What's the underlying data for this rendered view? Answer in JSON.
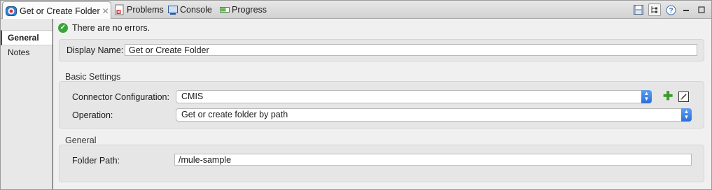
{
  "tabs": [
    {
      "label": "Get or Create Folder",
      "icon": "mule-connector-icon"
    },
    {
      "label": "Problems",
      "icon": "problems-icon"
    },
    {
      "label": "Console",
      "icon": "console-icon"
    },
    {
      "label": "Progress",
      "icon": "progress-icon"
    }
  ],
  "close_glyph": "✕",
  "nav": {
    "items": [
      {
        "label": "General"
      },
      {
        "label": "Notes"
      }
    ]
  },
  "status": {
    "text": "There are no errors."
  },
  "display_name": {
    "label": "Display Name:",
    "value": "Get or Create Folder"
  },
  "basic_settings": {
    "title": "Basic Settings",
    "connector": {
      "label": "Connector Configuration:",
      "value": "CMIS"
    },
    "operation": {
      "label": "Operation:",
      "value": "Get or create folder by path"
    }
  },
  "general": {
    "title": "General",
    "folder_path": {
      "label": "Folder Path:",
      "value": "/mule-sample"
    }
  },
  "colors": {
    "accent": "#2b6fd8",
    "ok": "#3aa53a",
    "add": "#3c9a2a"
  }
}
